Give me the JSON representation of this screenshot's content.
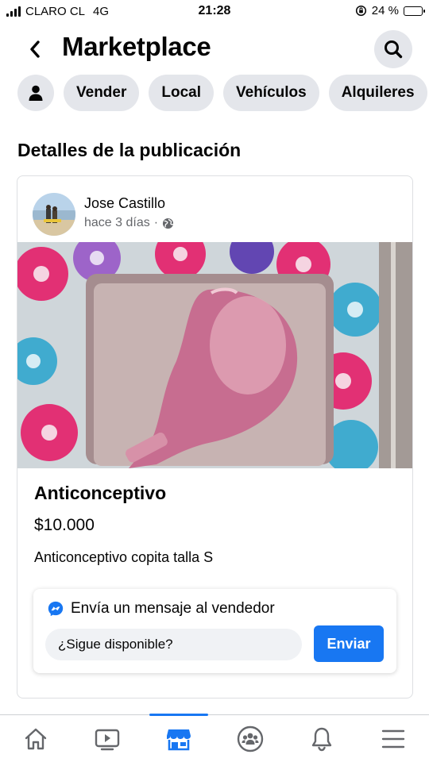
{
  "status_bar": {
    "carrier": "CLARO CL",
    "network": "4G",
    "time": "21:28",
    "battery": "24 %",
    "battery_level": 0.24
  },
  "header": {
    "back_icon": "chevron-left-icon",
    "title": "Marketplace",
    "search_icon": "search-icon"
  },
  "chips": {
    "profile_icon": "person-icon",
    "items": [
      {
        "label": "Vender"
      },
      {
        "label": "Local"
      },
      {
        "label": "Vehículos"
      },
      {
        "label": "Alquileres"
      }
    ]
  },
  "section_title": "Detalles de la publicación",
  "listing": {
    "seller_name": "Jose Castillo",
    "posted": "hace 3 días",
    "visibility_icon": "globe-icon",
    "title": "Anticonceptivo",
    "price": "$10.000",
    "description": "Anticonceptivo copita talla S"
  },
  "message": {
    "header": "Envía un mensaje al vendedor",
    "messenger_icon": "messenger-icon",
    "input_value": "¿Sigue disponible?",
    "send_label": "Enviar"
  },
  "bottom_nav": {
    "tabs": [
      {
        "icon": "home-icon"
      },
      {
        "icon": "video-icon"
      },
      {
        "icon": "marketplace-icon"
      },
      {
        "icon": "groups-icon"
      },
      {
        "icon": "bell-icon"
      },
      {
        "icon": "menu-icon"
      }
    ],
    "active_index": 2
  },
  "colors": {
    "accent": "#1877f2",
    "chip_bg": "#e4e6eb",
    "secondary_text": "#65676b"
  }
}
